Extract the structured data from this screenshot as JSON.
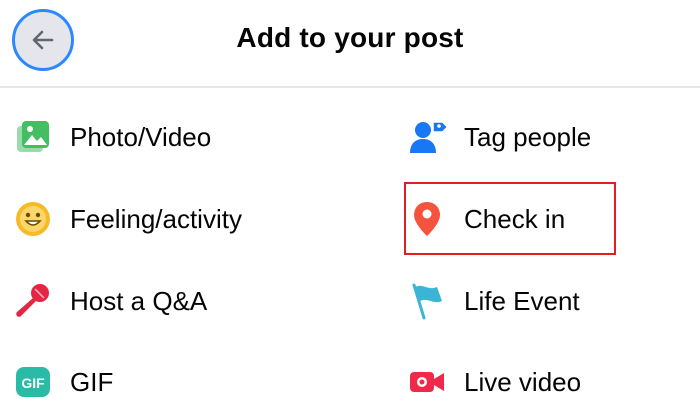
{
  "header": {
    "title": "Add to your post",
    "back_icon": "arrow-left-icon"
  },
  "options": {
    "photo_video": {
      "label": "Photo/Video",
      "icon": "photo-icon",
      "color": "#45bd62"
    },
    "tag_people": {
      "label": "Tag people",
      "icon": "tag-people-icon",
      "color": "#1877f2"
    },
    "feeling_activity": {
      "label": "Feeling/activity",
      "icon": "smiley-icon",
      "color": "#f7b928"
    },
    "check_in": {
      "label": "Check in",
      "icon": "location-pin-icon",
      "color": "#f5533d"
    },
    "host_qa": {
      "label": "Host a Q&A",
      "icon": "microphone-icon",
      "color": "#e42645"
    },
    "life_event": {
      "label": "Life Event",
      "icon": "flag-icon",
      "color": "#3ab5d6"
    },
    "gif": {
      "label": "GIF",
      "icon": "gif-icon",
      "color": "#2abba7"
    },
    "live_video": {
      "label": "Live video",
      "icon": "live-video-icon",
      "color": "#f02849"
    }
  },
  "highlight": {
    "target": "check_in",
    "color": "#e02020"
  }
}
